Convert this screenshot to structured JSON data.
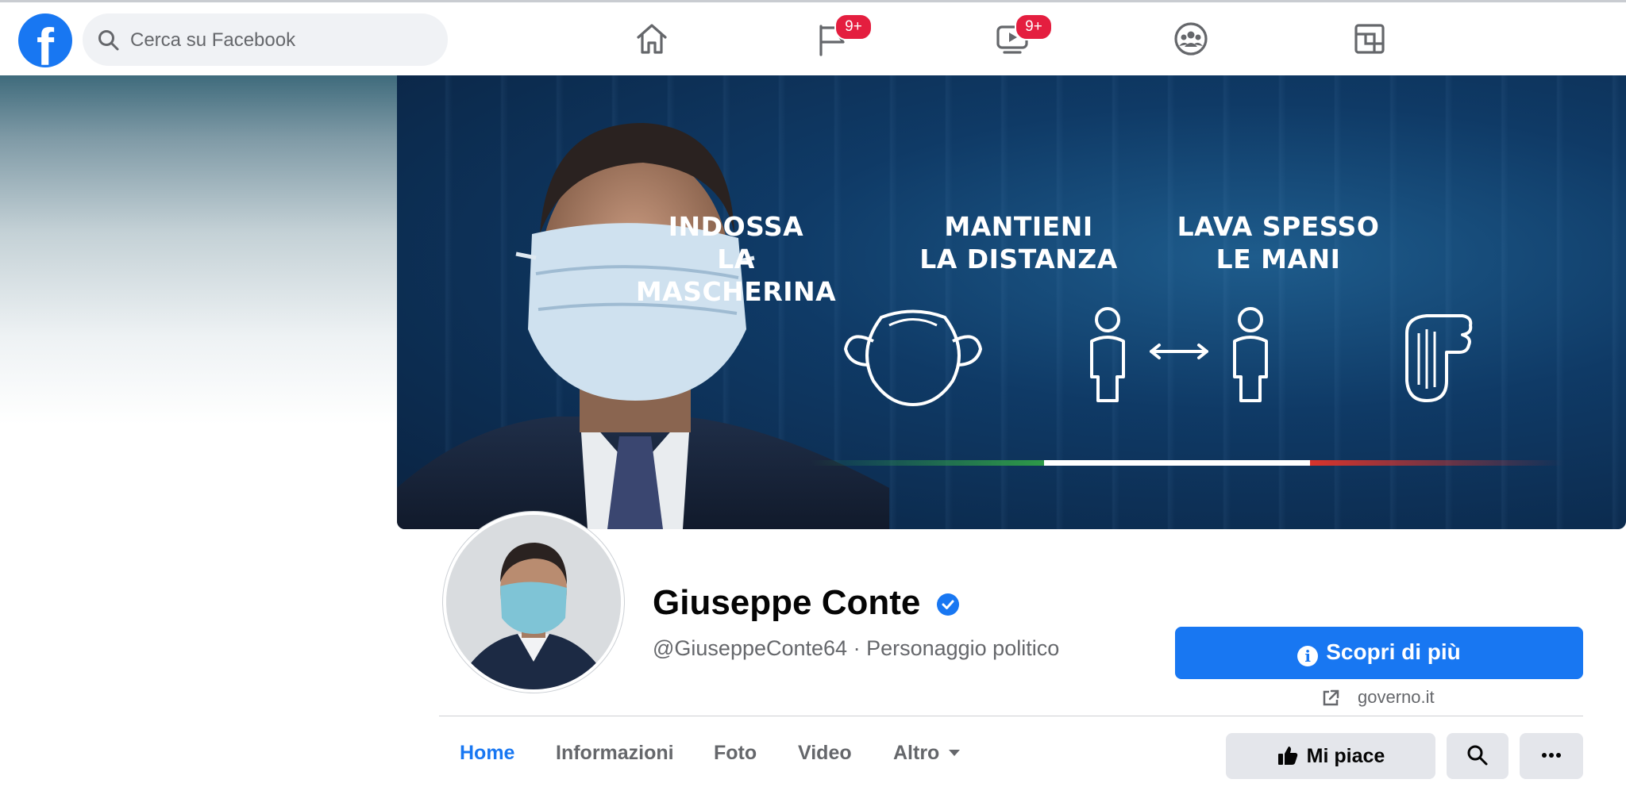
{
  "search": {
    "placeholder": "Cerca su Facebook"
  },
  "nav": {
    "home_icon": "home-icon",
    "pages_badge": "9+",
    "watch_badge": "9+",
    "groups_icon": "groups-icon",
    "gaming_icon": "gaming-icon"
  },
  "cover": {
    "messages": [
      {
        "line1": "INDOSSA",
        "line2": "LA MASCHERINA"
      },
      {
        "line1": "MANTIENI",
        "line2": "LA DISTANZA"
      },
      {
        "line1": "LAVA SPESSO",
        "line2": "LE MANI"
      }
    ],
    "flag_colors": [
      "#2e9a48",
      "#ffffff",
      "#d8342c"
    ]
  },
  "profile": {
    "name": "Giuseppe Conte",
    "handle": "@GiuseppeConte64 · Personaggio politico",
    "cta_label": "Scopri di più",
    "website": "governo.it"
  },
  "tabs": [
    "Home",
    "Informazioni",
    "Foto",
    "Video",
    "Altro"
  ],
  "actions": {
    "like_label": "Mi piace"
  },
  "colors": {
    "brand": "#1877f2",
    "badge": "#e41e3f"
  }
}
